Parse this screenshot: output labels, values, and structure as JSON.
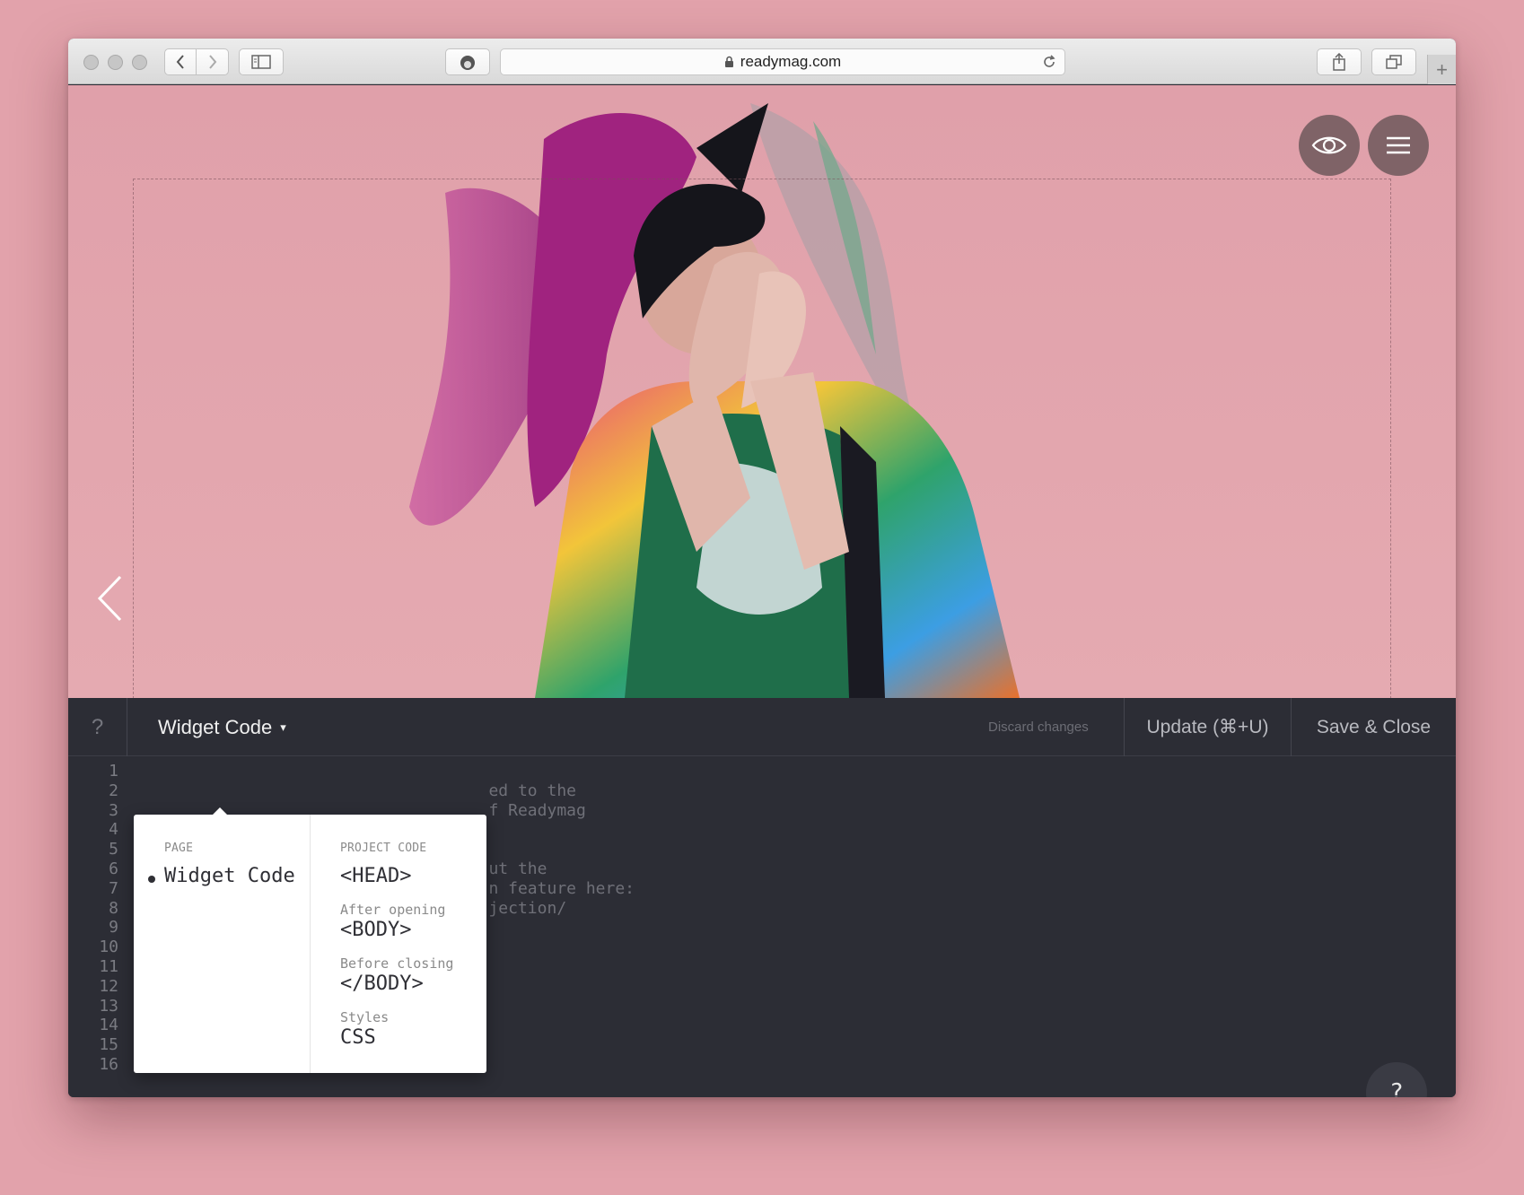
{
  "browser": {
    "url": "readymag.com",
    "new_tab_symbol": "+"
  },
  "canvas": {
    "background_color": "#e2a6ad",
    "image_subject": "fashion-portrait"
  },
  "toolbar": {
    "help_label": "?",
    "title": "Widget Code",
    "caret": "▾",
    "discard_label": "Discard changes",
    "update_label": "Update (⌘+U)",
    "save_close_label": "Save & Close"
  },
  "code": {
    "line_numbers": [
      "1",
      "2",
      "3",
      "4",
      "5",
      "6",
      "7",
      "8",
      "9",
      "10",
      "11",
      "12",
      "13",
      "14",
      "15",
      "16"
    ],
    "lines": [
      "",
      "                                  ed to the",
      "                                  f Readymag",
      "",
      "",
      "                                  ut the",
      "                                  n feature here:",
      "                                  jection/",
      "",
      "",
      "",
      "",
      "",
      "/___/_____\\",
      "-----------",
      "-->"
    ]
  },
  "dropdown": {
    "page_heading": "PAGE",
    "page_item": "Widget Code",
    "project_heading": "PROJECT CODE",
    "head_item": "<HEAD>",
    "after_opening_label": "After opening",
    "body_item": "<BODY>",
    "before_closing_label": "Before closing",
    "body_close_item": "</BODY>",
    "styles_label": "Styles",
    "css_item": "CSS"
  },
  "help_button": "?"
}
